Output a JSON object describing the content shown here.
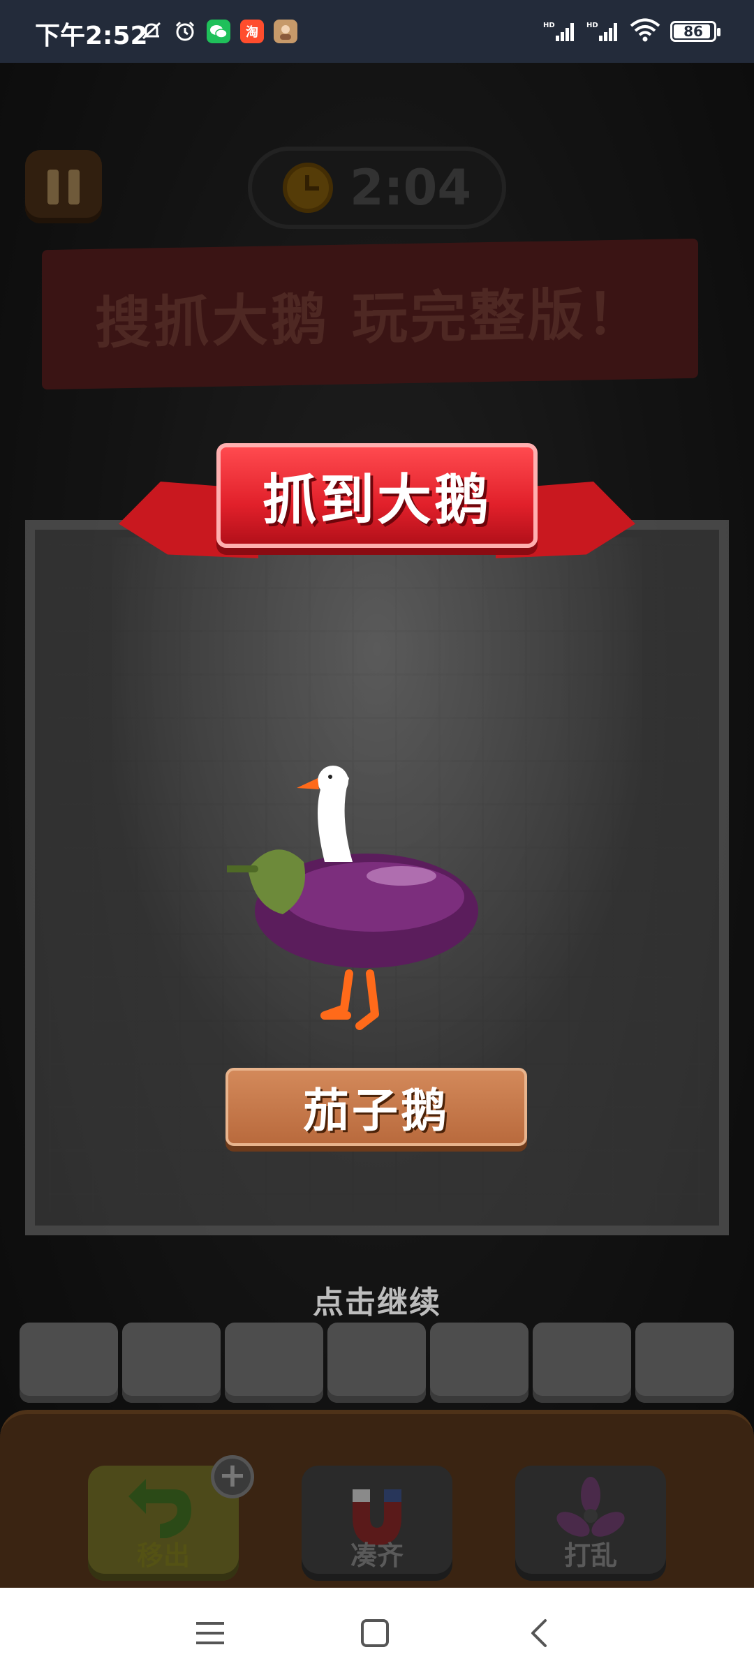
{
  "status_bar": {
    "time": "下午2:52",
    "battery": "86",
    "battery_level": 0.86,
    "left_icons": [
      "mute-bell-icon",
      "alarm-icon",
      "wechat-icon",
      "taobao-icon",
      "avatar-app-icon"
    ],
    "taobao_label": "淘",
    "right_icons": [
      "hd-signal-icon",
      "hd-signal-icon",
      "wifi-icon",
      "battery-icon"
    ],
    "hd_label": "HD"
  },
  "game": {
    "timer": "2:04",
    "background_banner": "搜抓大鹅 玩完整版！",
    "ribbon_title": "抓到大鹅",
    "goose_name": "茄子鹅",
    "continue_hint": "点击继续",
    "slot_count": 7,
    "tools": [
      {
        "label": "移出",
        "icon": "undo-arrow-icon"
      },
      {
        "label": "凑齐",
        "icon": "magnet-icon"
      },
      {
        "label": "打乱",
        "icon": "fan-shuffle-icon"
      }
    ],
    "plus_symbol": "+"
  },
  "nav": {
    "icons": [
      "menu-icon",
      "home-icon",
      "back-icon"
    ]
  },
  "colors": {
    "status_bg": "#232b3a",
    "ribbon_red": "#e1202a",
    "plate_brown": "#c47a4a"
  }
}
